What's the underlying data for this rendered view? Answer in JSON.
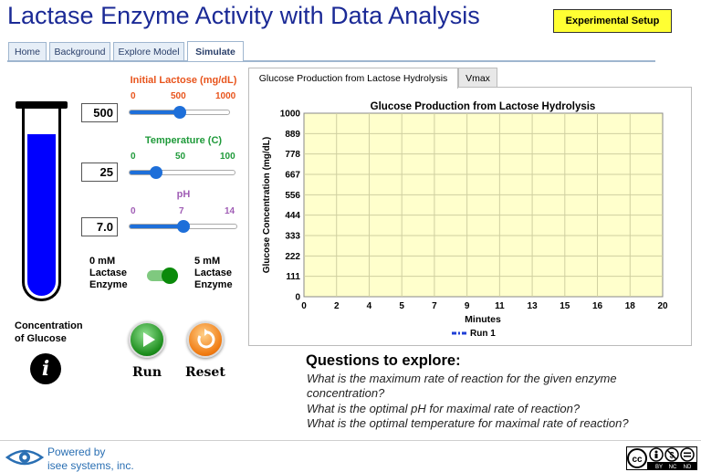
{
  "app": {
    "title": "Lactase Enzyme Activity with Data Analysis",
    "setup_button": "Experimental Setup"
  },
  "nav": {
    "tabs": [
      "Home",
      "Background",
      "Explore Model",
      "Simulate"
    ],
    "active": "Simulate"
  },
  "controls": {
    "lactose": {
      "label": "Initial Lactose (mg/dL)",
      "min": "0",
      "mid": "500",
      "max": "1000",
      "value": "500",
      "level": 0.5,
      "color": "#e8541c"
    },
    "temperature": {
      "label": "Temperature (C)",
      "min": "0",
      "mid": "50",
      "max": "100",
      "value": "25",
      "level": 0.25,
      "color": "#1f9a3a"
    },
    "ph": {
      "label": "pH",
      "min": "0",
      "mid": "7",
      "max": "14",
      "value": "7.0",
      "level": 0.5,
      "color": "#a05db5"
    },
    "enzyme": {
      "left_label": "0 mM\nLactase\nEnzyme",
      "right_label": "5 mM\nLactase\nEnzyme",
      "state": "on"
    }
  },
  "tube": {
    "fill_level": 0.83,
    "liquid_color": "#0000ff"
  },
  "concentration_label": "Concentration\nof Glucose",
  "buttons": {
    "run": "Run",
    "reset": "Reset"
  },
  "chart_tabs": [
    "Glucose Production from Lactose Hydrolysis",
    "Vmax"
  ],
  "chart_data": {
    "type": "line",
    "title": "Glucose Production from Lactose Hydrolysis",
    "xlabel": "Minutes",
    "ylabel": "Glucose Concentration (mg/dL)",
    "xlim": [
      0,
      20
    ],
    "ylim": [
      0,
      1000
    ],
    "x_ticks": [
      "0",
      "2",
      "4",
      "5",
      "7",
      "9",
      "11",
      "13",
      "15",
      "16",
      "18",
      "20"
    ],
    "y_ticks": [
      "0",
      "111",
      "222",
      "333",
      "444",
      "556",
      "667",
      "778",
      "889",
      "1000"
    ],
    "grid": true,
    "plot_background": "#ffffcc",
    "series": [
      {
        "name": "Run 1",
        "color": "#1f3fd6",
        "values": []
      }
    ],
    "legend_position": "bottom-center"
  },
  "questions": {
    "title": "Questions to explore:",
    "items": [
      "What is the maximum rate of reaction for the given enzyme",
      "concentration?",
      "What is the optimal pH for maximal rate of reaction?",
      "What is the optimal temperature for maximal rate of reaction?"
    ]
  },
  "footer": {
    "powered_line1": "Powered by",
    "powered_line2": "isee systems, inc.",
    "license_labels": [
      "BY",
      "NC",
      "ND"
    ]
  }
}
